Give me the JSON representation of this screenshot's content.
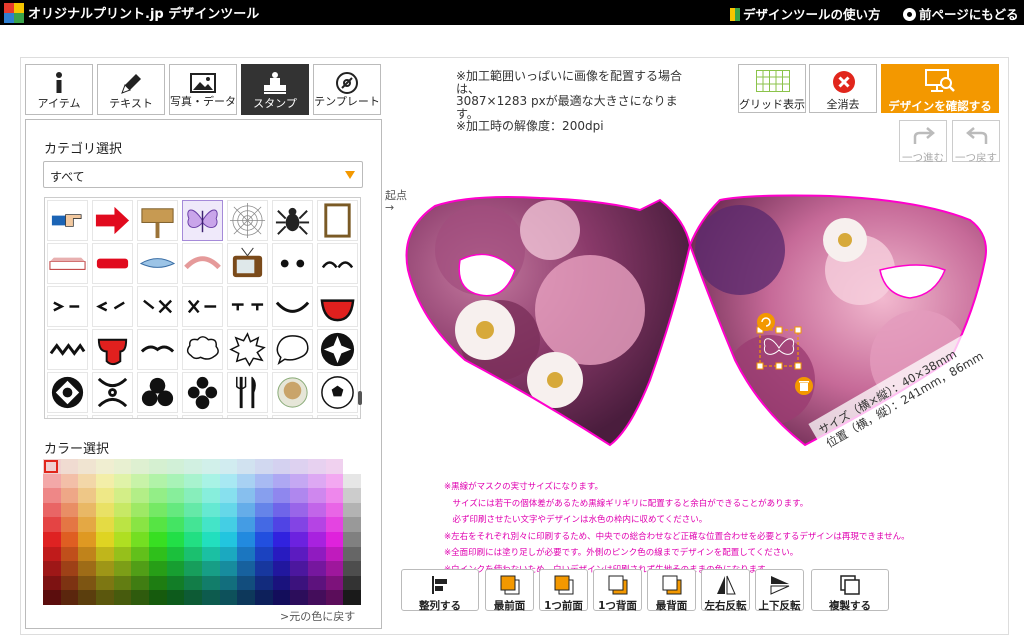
{
  "header": {
    "title": "オリジナルプリント.jp デザインツール",
    "help_link": "デザインツールの使い方",
    "back_link": "前ページにもどる"
  },
  "tabs": [
    {
      "label": "アイテム",
      "icon": "info-icon"
    },
    {
      "label": "テキスト",
      "icon": "pen-icon"
    },
    {
      "label": "写真・データ",
      "icon": "image-icon"
    },
    {
      "label": "スタンプ",
      "icon": "stamp-icon",
      "active": true
    },
    {
      "label": "テンプレート",
      "icon": "template-icon"
    }
  ],
  "stamp_panel": {
    "category_title": "カテゴリ選択",
    "category_value": "すべて",
    "color_title": "カラー選択",
    "revert_link": ">元の色に戻す"
  },
  "info": {
    "line1": "※加工範囲いっぱいに画像を配置する場合は、",
    "line2": "3087×1283 pxが最適な大きさになります。",
    "line3": "※加工時の解像度：200dpi"
  },
  "start_hint": "起点\n→",
  "toolbar": {
    "grid_label": "グリッド表示",
    "clear_label": "全消去",
    "confirm_label": "デザインを確認する",
    "redo_label": "一つ進む",
    "undo_label": "一つ戻す"
  },
  "canvas": {
    "size_text": "サイズ（横×縦）：40×38mm",
    "position_text": "位置（横，縦）：241mm，86mm"
  },
  "notes": [
    "※黒線がマスクの実寸サイズになります。",
    "　サイズには若干の個体差があるため黒線ギリギリに配置すると余白ができることがあります。",
    "　必ず印刷させたい文字やデザインは水色の枠内に収めてください。",
    "※左右をそれぞれ別々に印刷するため、中央での総合わせなど正確な位置合わせを必要とするデザインは再現できません。",
    "※全面印刷には塗り足しが必要です。外側のピンク色の線までデザインを配置してください。",
    "※白インクを使わないため、白いデザインは印刷されず生地そのままの色になります。"
  ],
  "bottom_buttons": [
    {
      "label": "整列する",
      "icon": "align-icon"
    },
    {
      "label": "最前面",
      "icon": "bring-front-icon"
    },
    {
      "label": "1つ前面",
      "icon": "bring-forward-icon"
    },
    {
      "label": "1つ背面",
      "icon": "send-backward-icon"
    },
    {
      "label": "最背面",
      "icon": "send-back-icon"
    },
    {
      "label": "左右反転",
      "icon": "flip-horizontal-icon"
    },
    {
      "label": "上下反転",
      "icon": "flip-vertical-icon"
    },
    {
      "label": "複製する",
      "icon": "duplicate-icon"
    }
  ],
  "colors": {
    "accent_orange": "#f39800",
    "clear_red": "#e1261c",
    "mask_outline": "#ff00cc",
    "note_magenta": "#e000b0"
  }
}
